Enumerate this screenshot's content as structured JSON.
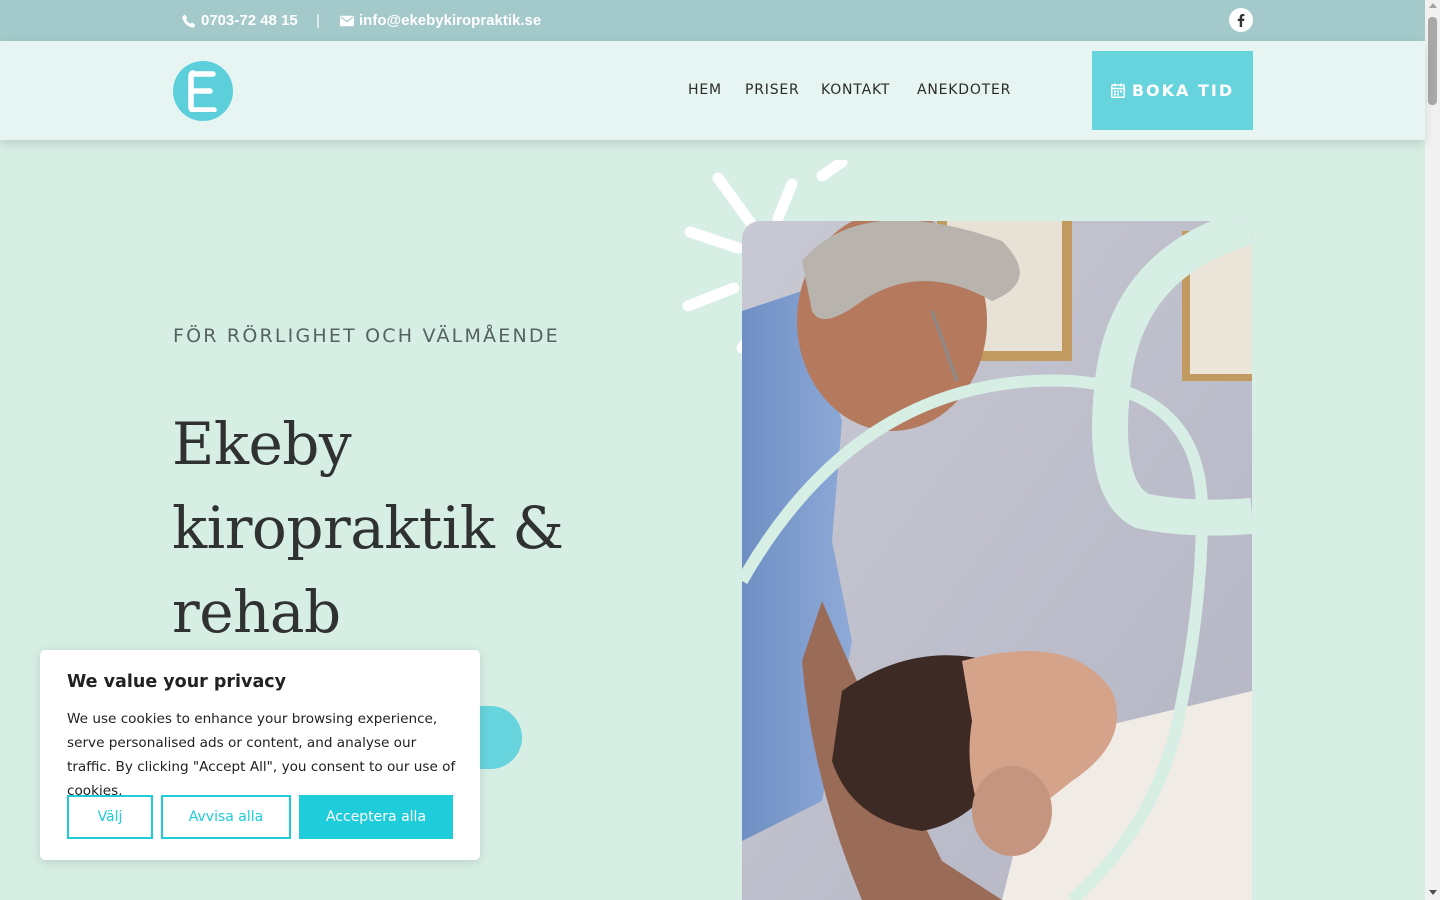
{
  "topbar": {
    "phone": "0703-72 48 15",
    "separator": "|",
    "email": "info@ekebykiropraktik.se",
    "social_icon": "facebook-icon"
  },
  "header": {
    "logo_letter": "E",
    "nav": [
      "HEM",
      "PRISER",
      "KONTAKT",
      "ANEKDOTER"
    ],
    "book_label": "BOKA TID",
    "book_icon": "calendar-icon"
  },
  "hero": {
    "kicker": "FÖR RÖRLIGHET OCH VÄLMÅENDE",
    "title_lines": [
      "Ekeby",
      "kiropraktik &",
      "rehab"
    ]
  },
  "cookie": {
    "title": "We value your privacy",
    "text": "We use cookies to enhance your browsing experience, serve personalised ads or content, and analyse our traffic. By clicking \"Accept All\", you consent to our use of cookies.",
    "choose": "Välj",
    "reject": "Avvisa alla",
    "accept": "Acceptera alla"
  },
  "colors": {
    "topbar": "#a3c9ca",
    "header": "#e6f5f1",
    "background": "#d6eee4",
    "accent": "#67d3dd",
    "cookie_accent": "#1ecdd9"
  }
}
